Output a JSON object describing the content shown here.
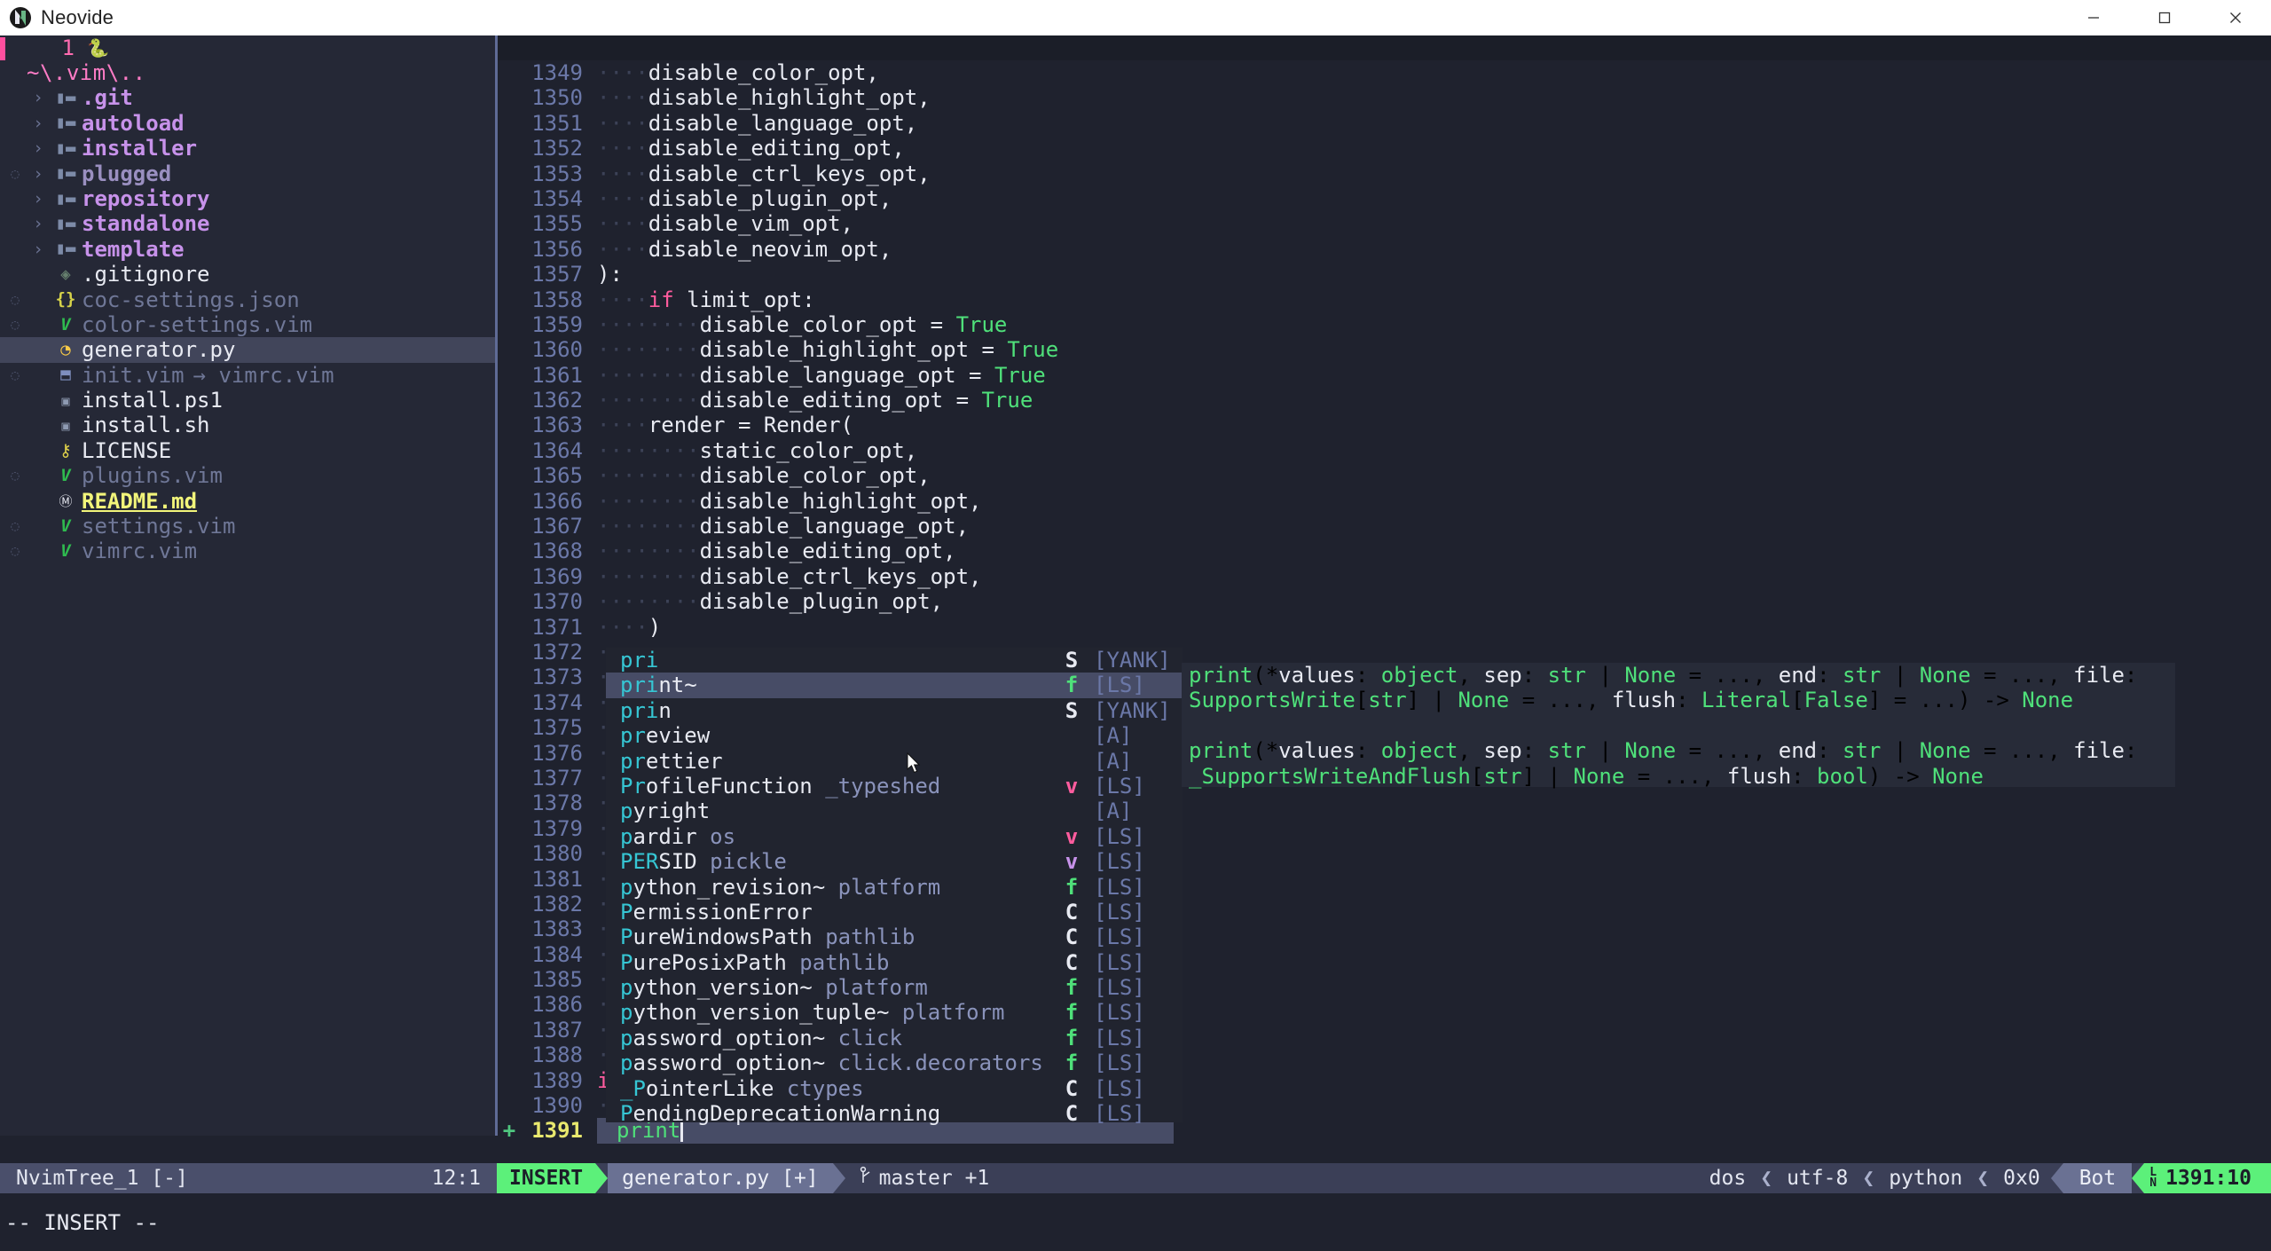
{
  "window": {
    "app_title": "Neovide",
    "app_icon": "neovide-logo-icon",
    "minimize_label": "—",
    "maximize_label": "□",
    "close_label": "✕"
  },
  "sidebar": {
    "topline_number": "1",
    "topline_icon": "python-icon",
    "root_label": "~\\.vim\\..",
    "items": [
      {
        "name": ".git",
        "type": "folder",
        "arrow": "›",
        "icon": "folder-icon",
        "git": false,
        "style": "folder"
      },
      {
        "name": "autoload",
        "type": "folder",
        "arrow": "›",
        "icon": "folder-icon",
        "git": false,
        "style": "folder"
      },
      {
        "name": "installer",
        "type": "folder",
        "arrow": "›",
        "icon": "folder-icon",
        "git": false,
        "style": "folder"
      },
      {
        "name": "plugged",
        "type": "folder",
        "arrow": "›",
        "icon": "folder-icon",
        "git": true,
        "style": "folder-dim"
      },
      {
        "name": "repository",
        "type": "folder",
        "arrow": "›",
        "icon": "folder-icon",
        "git": false,
        "style": "folder"
      },
      {
        "name": "standalone",
        "type": "folder",
        "arrow": "›",
        "icon": "folder-icon",
        "git": false,
        "style": "folder"
      },
      {
        "name": "template",
        "type": "folder",
        "arrow": "›",
        "icon": "folder-icon",
        "git": false,
        "style": "folder"
      },
      {
        "name": ".gitignore",
        "type": "file",
        "arrow": "",
        "icon": "gitignore-icon",
        "git": false,
        "style": "white"
      },
      {
        "name": "coc-settings.json",
        "type": "file",
        "arrow": "",
        "icon": "json-icon",
        "git": true,
        "style": "dim"
      },
      {
        "name": "color-settings.vim",
        "type": "file",
        "arrow": "",
        "icon": "vim-icon",
        "git": true,
        "style": "dim"
      },
      {
        "name": "generator.py",
        "type": "file",
        "arrow": "",
        "icon": "python-icon",
        "git": false,
        "style": "white",
        "selected": true
      },
      {
        "name": "init.vim",
        "extra": "→ vimrc.vim",
        "type": "file",
        "arrow": "",
        "icon": "symlink-icon",
        "git": true,
        "style": "dim"
      },
      {
        "name": "install.ps1",
        "type": "file",
        "arrow": "",
        "icon": "shell-icon",
        "git": false,
        "style": "white"
      },
      {
        "name": "install.sh",
        "type": "file",
        "arrow": "",
        "icon": "shell-icon",
        "git": false,
        "style": "white"
      },
      {
        "name": "LICENSE",
        "type": "file",
        "arrow": "",
        "icon": "key-icon",
        "git": false,
        "style": "white"
      },
      {
        "name": "plugins.vim",
        "type": "file",
        "arrow": "",
        "icon": "vim-icon",
        "git": true,
        "style": "dim"
      },
      {
        "name": "README.md",
        "type": "file",
        "arrow": "",
        "icon": "markdown-icon",
        "git": false,
        "style": "readme"
      },
      {
        "name": "settings.vim",
        "type": "file",
        "arrow": "",
        "icon": "vim-icon",
        "git": true,
        "style": "dim"
      },
      {
        "name": "vimrc.vim",
        "type": "file",
        "arrow": "",
        "icon": "vim-icon",
        "git": true,
        "style": "dim"
      }
    ]
  },
  "editor": {
    "lines": [
      {
        "no": "1349",
        "indent": "····",
        "text": "disable_color_opt,"
      },
      {
        "no": "1350",
        "indent": "····",
        "text": "disable_highlight_opt,"
      },
      {
        "no": "1351",
        "indent": "····",
        "text": "disable_language_opt,"
      },
      {
        "no": "1352",
        "indent": "····",
        "text": "disable_editing_opt,"
      },
      {
        "no": "1353",
        "indent": "····",
        "text": "disable_ctrl_keys_opt,"
      },
      {
        "no": "1354",
        "indent": "····",
        "text": "disable_plugin_opt,"
      },
      {
        "no": "1355",
        "indent": "····",
        "text": "disable_vim_opt,"
      },
      {
        "no": "1356",
        "indent": "····",
        "text": "disable_neovim_opt,"
      },
      {
        "no": "1357",
        "indent": "",
        "text": "):"
      },
      {
        "no": "1358",
        "indent": "····",
        "kw": "if ",
        "text": "limit_opt:"
      },
      {
        "no": "1359",
        "indent": "········",
        "text": "disable_color_opt = ",
        "bool": "True"
      },
      {
        "no": "1360",
        "indent": "········",
        "text": "disable_highlight_opt = ",
        "bool": "True"
      },
      {
        "no": "1361",
        "indent": "········",
        "text": "disable_language_opt = ",
        "bool": "True"
      },
      {
        "no": "1362",
        "indent": "········",
        "text": "disable_editing_opt = ",
        "bool": "True"
      },
      {
        "no": "1363",
        "indent": "····",
        "text": "render = Render("
      },
      {
        "no": "1364",
        "indent": "········",
        "text": "static_color_opt,"
      },
      {
        "no": "1365",
        "indent": "········",
        "text": "disable_color_opt,"
      },
      {
        "no": "1366",
        "indent": "········",
        "text": "disable_highlight_opt,"
      },
      {
        "no": "1367",
        "indent": "········",
        "text": "disable_language_opt,"
      },
      {
        "no": "1368",
        "indent": "········",
        "text": "disable_editing_opt,"
      },
      {
        "no": "1369",
        "indent": "········",
        "text": "disable_ctrl_keys_opt,"
      },
      {
        "no": "1370",
        "indent": "········",
        "text": "disable_plugin_opt,"
      },
      {
        "no": "1371",
        "indent": "····",
        "text": ")"
      },
      {
        "no": "1372",
        "indent": "··",
        "text": ""
      },
      {
        "no": "1373",
        "indent": "··",
        "text": ""
      },
      {
        "no": "1374",
        "indent": "··",
        "text": ""
      },
      {
        "no": "1375",
        "indent": "··",
        "text": ""
      },
      {
        "no": "1376",
        "indent": "··",
        "text": ""
      },
      {
        "no": "1377",
        "indent": "··",
        "text": ""
      },
      {
        "no": "1378",
        "indent": "··",
        "text": ""
      },
      {
        "no": "1379",
        "indent": "··",
        "text": ""
      },
      {
        "no": "1380",
        "indent": "··",
        "text": ""
      },
      {
        "no": "1381",
        "indent": "··",
        "text": ""
      },
      {
        "no": "1382",
        "indent": "··",
        "text": ""
      },
      {
        "no": "1383",
        "indent": "··",
        "text": ""
      },
      {
        "no": "1384",
        "indent": "··",
        "text": ""
      },
      {
        "no": "1385",
        "indent": "··",
        "text": ""
      },
      {
        "no": "1386",
        "indent": "··",
        "text": ""
      },
      {
        "no": "1387",
        "indent": "··",
        "text": ""
      },
      {
        "no": "1388",
        "indent": "··",
        "text": ""
      },
      {
        "no": "1389",
        "indent": "",
        "kw": "if ",
        "text": ""
      },
      {
        "no": "1390",
        "indent": "··",
        "text": ""
      }
    ],
    "current_line": {
      "no": "1391",
      "sign": "+",
      "text": "print"
    }
  },
  "completion": {
    "items": [
      {
        "match": "pri",
        "rest": "",
        "detail": "",
        "kind": "S",
        "kind_class": "k-S",
        "source": "[YANK]",
        "selected": false
      },
      {
        "match": "pri",
        "rest": "nt~",
        "detail": "",
        "kind": "f",
        "kind_class": "k-f",
        "source": "[LS]",
        "selected": true
      },
      {
        "match": "pri",
        "rest": "n",
        "detail": "",
        "kind": "S",
        "kind_class": "k-S",
        "source": "[YANK]",
        "selected": false
      },
      {
        "match": "pr",
        "rest": "eview",
        "detail": "",
        "kind": "",
        "kind_class": "",
        "source": "[A]",
        "selected": false
      },
      {
        "match": "pr",
        "rest": "ettier",
        "detail": "",
        "kind": "",
        "kind_class": "",
        "source": "[A]",
        "selected": false
      },
      {
        "match": "Pr",
        "rest": "ofileFunction",
        "detail": "_typeshed",
        "kind": "v",
        "kind_class": "k-v",
        "source": "[LS]",
        "selected": false
      },
      {
        "match": "p",
        "rest": "yright",
        "detail": "",
        "kind": "",
        "kind_class": "",
        "source": "[A]",
        "selected": false
      },
      {
        "match": "p",
        "rest": "ardir",
        "detail": "os",
        "kind": "v",
        "kind_class": "k-v",
        "source": "[LS]",
        "selected": false
      },
      {
        "match": "PER",
        "rest": "SID",
        "detail": "pickle",
        "kind": "v",
        "kind_class": "k-v2",
        "source": "[LS]",
        "selected": false
      },
      {
        "match": "p",
        "rest": "ython_revision~",
        "detail": "platform",
        "kind": "f",
        "kind_class": "k-f",
        "source": "[LS]",
        "selected": false
      },
      {
        "match": "P",
        "rest": "ermissionError",
        "detail": "",
        "kind": "C",
        "kind_class": "k-C",
        "source": "[LS]",
        "selected": false
      },
      {
        "match": "P",
        "rest": "ureWindowsPath",
        "detail": "pathlib",
        "kind": "C",
        "kind_class": "k-C",
        "source": "[LS]",
        "selected": false
      },
      {
        "match": "P",
        "rest": "urePosixPath",
        "detail": "pathlib",
        "kind": "C",
        "kind_class": "k-C",
        "source": "[LS]",
        "selected": false
      },
      {
        "match": "p",
        "rest": "ython_version~",
        "detail": "platform",
        "kind": "f",
        "kind_class": "k-f",
        "source": "[LS]",
        "selected": false
      },
      {
        "match": "p",
        "rest": "ython_version_tuple~",
        "detail": "platform",
        "kind": "f",
        "kind_class": "k-f",
        "source": "[LS]",
        "selected": false
      },
      {
        "match": "p",
        "rest": "assword_option~",
        "detail": "click",
        "kind": "f",
        "kind_class": "k-f",
        "source": "[LS]",
        "selected": false
      },
      {
        "match": "p",
        "rest": "assword_option~",
        "detail": "click.decorators",
        "kind": "f",
        "kind_class": "k-f",
        "source": "[LS]",
        "selected": false
      },
      {
        "match": "_P",
        "rest": "ointerLike",
        "detail": "ctypes",
        "kind": "C",
        "kind_class": "k-C",
        "source": "[LS]",
        "selected": false
      },
      {
        "match": "P",
        "rest": "endingDeprecationWarning",
        "detail": "",
        "kind": "C",
        "kind_class": "k-C",
        "source": "[LS]",
        "selected": false
      }
    ]
  },
  "documentation": {
    "block1_line1": "print(*values: object, sep: str | None = ..., end: str | None = ..., file:",
    "block1_line2": "SupportsWrite[str] | None = ..., flush: Literal[False] = ...) -> None",
    "block2_line1": "print(*values: object, sep: str | None = ..., end: str | None = ..., file:",
    "block2_line2": "_SupportsWriteAndFlush[str] | None = ..., flush: bool) -> None"
  },
  "statusline": {
    "tree_name": "NvimTree_1 [-]",
    "tree_pos": "12:1",
    "mode": "INSERT",
    "file": "generator.py [+]",
    "branch_icon": "git-branch-icon",
    "branch": "master +1",
    "fileformat": "dos",
    "encoding": "utf-8",
    "filetype": "python",
    "hex": "0x0",
    "scroll": "Bot",
    "position": "1391:10",
    "sep": "❮"
  },
  "cmdline": {
    "text": "-- INSERT --"
  },
  "colors": {
    "bg": "#1f222e",
    "sidebar_bg": "#252836",
    "accent_green": "#5cf07a",
    "accent_pink": "#ff5c9e",
    "purple": "#c792ea",
    "line_number": "#6b78a8"
  }
}
